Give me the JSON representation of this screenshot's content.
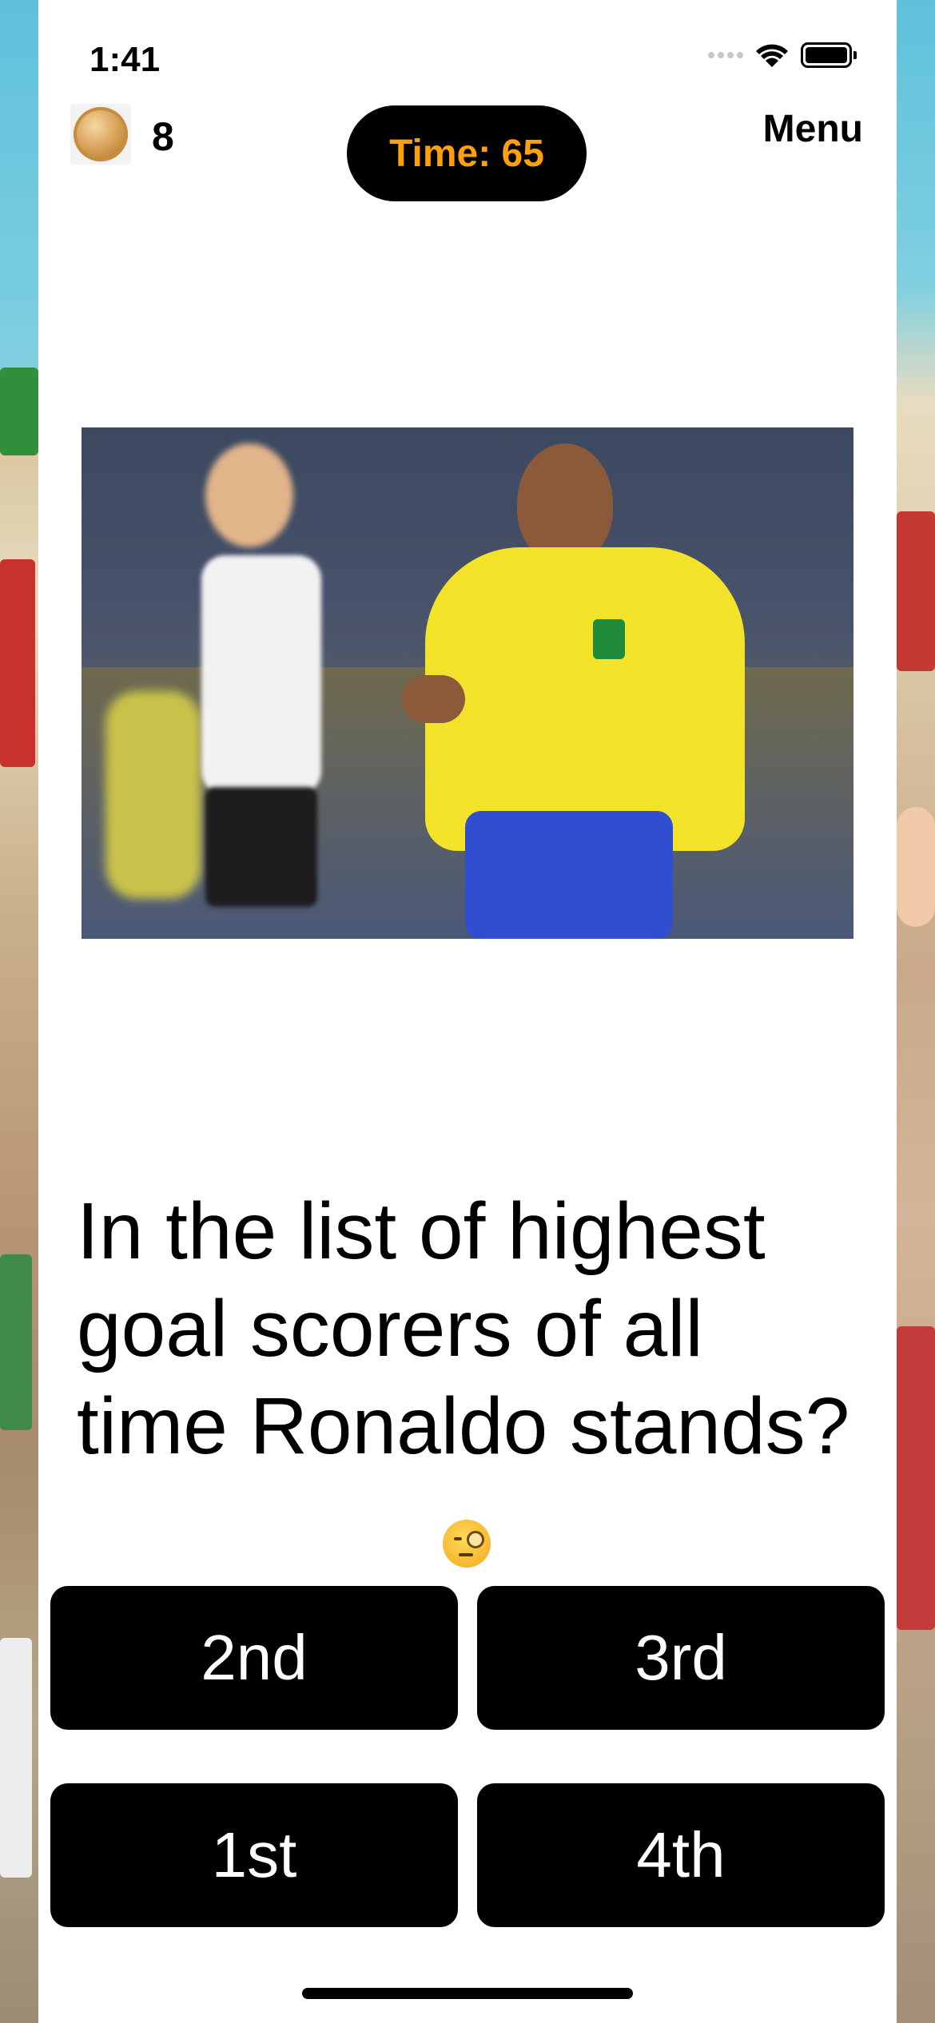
{
  "status": {
    "time": "1:41"
  },
  "header": {
    "coins": "8",
    "timer": "Time: 65",
    "menu_label": "Menu"
  },
  "quiz": {
    "question": "In the list of highest goal scorers of all time Ronaldo stands?",
    "answers": [
      "2nd",
      "3rd",
      "1st",
      "4th"
    ]
  },
  "icons": {
    "coin": "coin-icon",
    "thinking": "face-with-monocle-icon",
    "wifi": "wifi-icon",
    "battery": "battery-icon",
    "signal": "cellular-signal-icon"
  },
  "colors": {
    "timer_text": "#ff9f0a",
    "button_bg": "#000000",
    "button_text": "#ffffff"
  }
}
